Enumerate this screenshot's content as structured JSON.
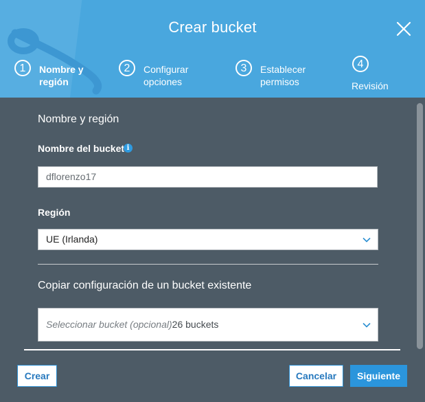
{
  "dialog": {
    "title": "Crear bucket"
  },
  "steps": [
    {
      "number": "1",
      "label_line1": "Nombre y",
      "label_line2": "región",
      "active": true
    },
    {
      "number": "2",
      "label_line1": "Configurar",
      "label_line2": "opciones",
      "active": false
    },
    {
      "number": "3",
      "label_line1": "Establecer",
      "label_line2": "permisos",
      "active": false
    },
    {
      "number": "4",
      "label_line1": "Revisión",
      "label_line2": "",
      "active": false
    }
  ],
  "section": {
    "title": "Nombre y región"
  },
  "bucket_name": {
    "label": "Nombre del bucket",
    "info_glyph": "i",
    "value": "dflorenzo17"
  },
  "region": {
    "label": "Región",
    "selected": "UE (Irlanda)"
  },
  "copy_config": {
    "title": "Copiar configuración de un bucket existente",
    "placeholder": "Seleccionar bucket (opcional)",
    "count": "26 buckets"
  },
  "footer": {
    "create_label": "Crear",
    "cancel_label": "Cancelar",
    "next_label": "Siguiente"
  },
  "colors": {
    "header": "#49a7de",
    "body": "#4d5b66",
    "accent": "#2b95dc"
  },
  "icons": {
    "close": "close-icon",
    "info": "info-icon",
    "dropdown": "chevron-down-icon"
  }
}
